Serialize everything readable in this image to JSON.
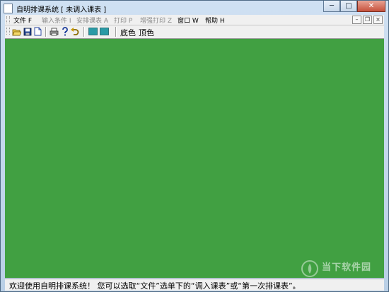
{
  "window": {
    "title": "自明排课系统",
    "document": "[ 未调入课表 ]",
    "buttons": {
      "minimize": "─",
      "maximize": "□",
      "close": "✕"
    }
  },
  "menu": {
    "items": [
      {
        "label": "文件 F",
        "enabled": true
      },
      {
        "label": "输入条件 I",
        "enabled": false
      },
      {
        "label": "安排课表 A",
        "enabled": false
      },
      {
        "label": "打印 P",
        "enabled": false
      },
      {
        "label": "增强打印 Z",
        "enabled": false
      },
      {
        "label": "窗口 W",
        "enabled": true
      },
      {
        "label": "帮助 H",
        "enabled": true
      }
    ],
    "mdi": {
      "minimize": "–",
      "restore": "❐",
      "close": "×"
    }
  },
  "toolbar": {
    "icons": [
      "open-folder-icon",
      "save-disk-icon",
      "new-document-icon",
      "print-icon",
      "help-question-icon",
      "undo-arrow-icon",
      "color-swatch-icon",
      "color-swatch-icon"
    ],
    "bg_color_label": "底色",
    "top_color_label": "顶色",
    "swatch_color": "#2a9aa6"
  },
  "main": {
    "background": "#41a042"
  },
  "status": {
    "message": "欢迎使用自明排课系统！ 您可以选取“文件”选单下的“调入课表”或“第一次排课表”。"
  },
  "watermark": {
    "name": "当下软件园"
  }
}
